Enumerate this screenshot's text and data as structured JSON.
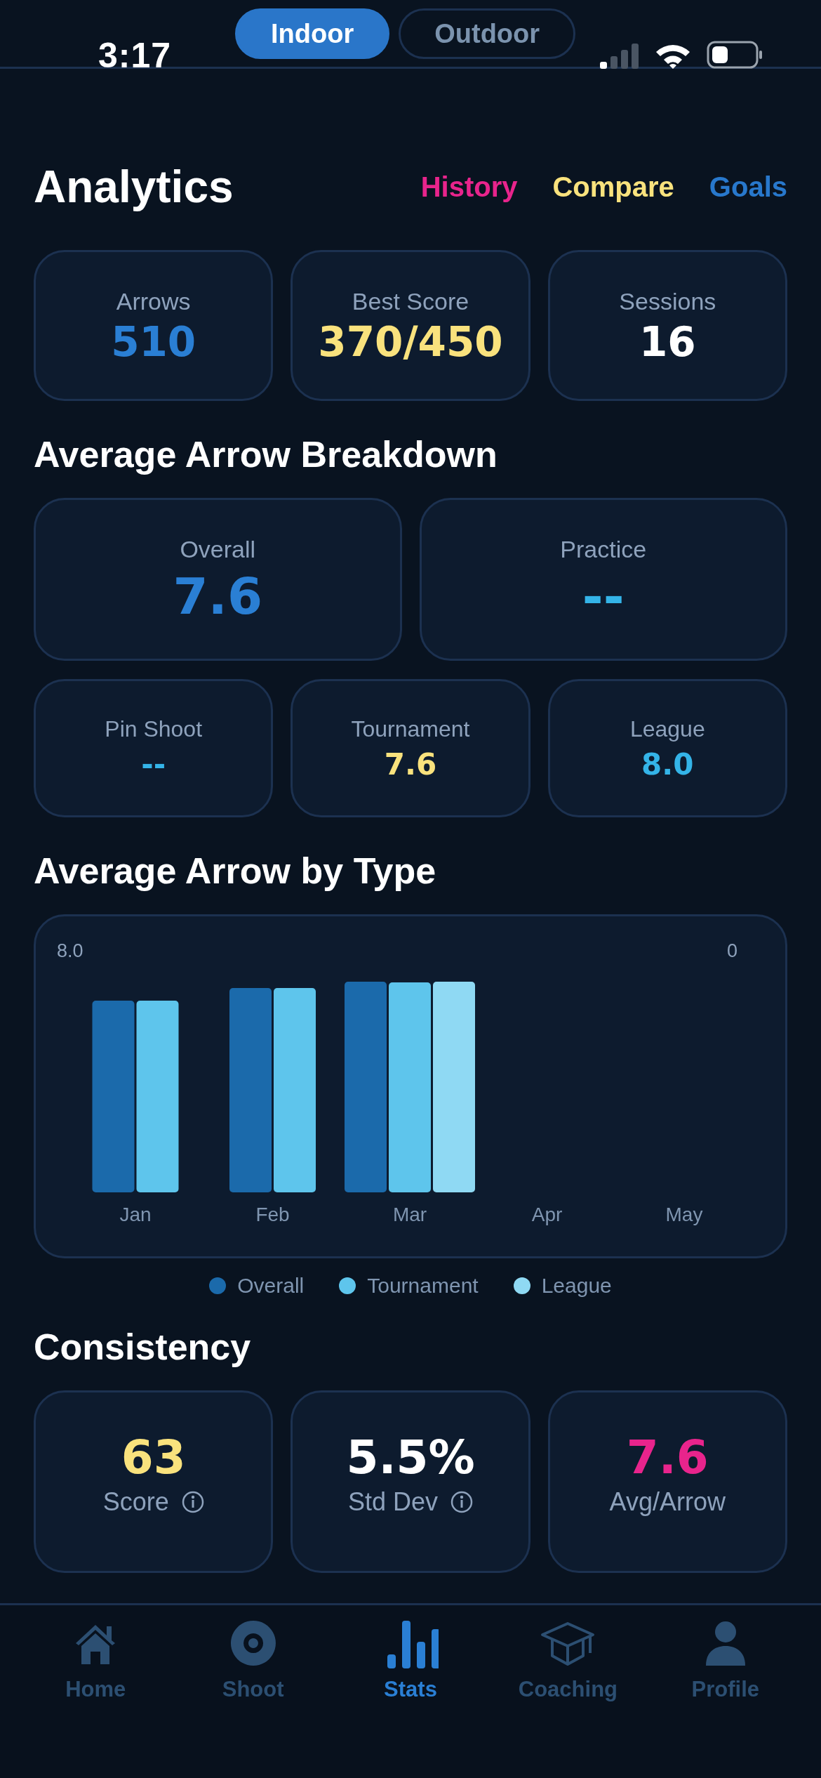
{
  "status_bar": {
    "time": "3:17"
  },
  "mode_toggle": [
    {
      "label": "Indoor",
      "selected": true
    },
    {
      "label": "Outdoor",
      "selected": false
    }
  ],
  "header": {
    "title": "Analytics",
    "links": [
      {
        "label": "History",
        "color": "#e8248c"
      },
      {
        "label": "Compare",
        "color": "#f9e27d"
      },
      {
        "label": "Goals",
        "color": "#2878cc"
      }
    ]
  },
  "summary": [
    {
      "label": "Arrows",
      "value": "510",
      "color": "#2a7fd4"
    },
    {
      "label": "Best Score",
      "value": "370/450",
      "color": "#f9e27d"
    },
    {
      "label": "Sessions",
      "value": "16",
      "color": "#ffffff"
    }
  ],
  "breakdown": {
    "title": "Average Arrow Breakdown",
    "main": [
      {
        "label": "Overall",
        "value": "7.6",
        "color": "#2a7fd4"
      },
      {
        "label": "Practice",
        "value": "--",
        "color": "#34b4e8"
      }
    ],
    "types": [
      {
        "label": "Pin Shoot",
        "value": "--",
        "color": "#34b4e8"
      },
      {
        "label": "Tournament",
        "value": "7.6",
        "color": "#f9e27d"
      },
      {
        "label": "League",
        "value": "8.0",
        "color": "#34b4e8"
      }
    ]
  },
  "by_type": {
    "title": "Average Arrow by Type",
    "corner_labels": [
      "8.0",
      "0"
    ],
    "months": [
      "Jan",
      "Feb",
      "Mar",
      "Apr",
      "May"
    ],
    "legend": [
      {
        "name": "Overall",
        "color": "#1b6aab"
      },
      {
        "name": "Tournament",
        "color": "#5ec5ec"
      },
      {
        "name": "League",
        "color": "#8fd9f3"
      }
    ]
  },
  "consistency": {
    "title": "Consistency",
    "items": [
      {
        "label": "Score",
        "value": "63",
        "color": "#f9e27d",
        "info": true
      },
      {
        "label": "Std Dev",
        "value": "5.5%",
        "color": "#ffffff",
        "info": true
      },
      {
        "label": "Avg/Arrow",
        "value": "7.6",
        "color": "#e8248c",
        "info": false
      }
    ]
  },
  "tab_bar": [
    {
      "label": "Home",
      "selected": false
    },
    {
      "label": "Shoot",
      "selected": false
    },
    {
      "label": "Stats",
      "selected": true
    },
    {
      "label": "Coaching",
      "selected": false
    },
    {
      "label": "Profile",
      "selected": false
    }
  ]
}
